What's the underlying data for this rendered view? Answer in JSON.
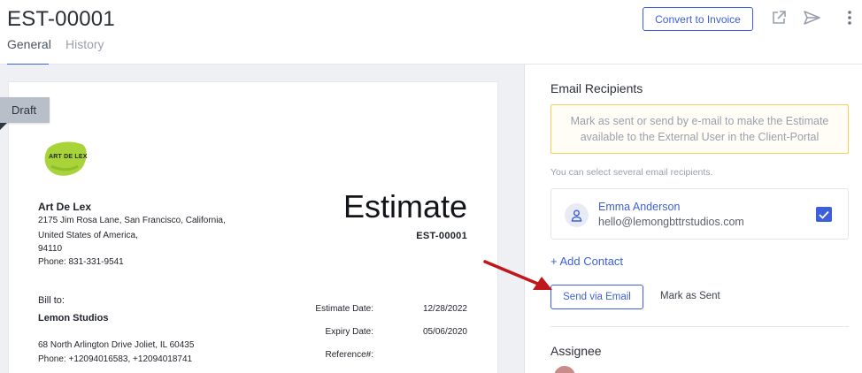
{
  "header": {
    "doc_id": "EST-00001",
    "tabs": [
      {
        "label": "General",
        "active": true
      },
      {
        "label": "History",
        "active": false
      }
    ],
    "convert_button": "Convert to Invoice",
    "icons": [
      "external-link-icon",
      "send-icon",
      "more-vertical-icon"
    ]
  },
  "document": {
    "draft_tag": "Draft",
    "logo_text": "ART DE LEX",
    "company": {
      "name": "Art De Lex",
      "address_line1": "2175 Jim Rosa Lane, San Francisco, California,",
      "address_line2": "United States of America,",
      "address_line3": "94110",
      "phone": "Phone: 831-331-9541"
    },
    "title": "Estimate",
    "number": "EST-00001",
    "bill_to": {
      "label": "Bill to:",
      "name": "Lemon Studios",
      "address": "68 North Arlington Drive Joliet, IL 60435",
      "phone": "Phone: +12094016583, +12094018741"
    },
    "meta": [
      {
        "label": "Estimate Date:",
        "value": "12/28/2022"
      },
      {
        "label": "Expiry Date:",
        "value": "05/06/2020"
      },
      {
        "label": "Reference#:",
        "value": ""
      }
    ]
  },
  "email_panel": {
    "title": "Email Recipients",
    "notice": "Mark as sent or send by e-mail to make the Estimate available to the External User in the Client-Portal",
    "hint": "You can select several email recipients.",
    "contact": {
      "name": "Emma Anderson",
      "email": "hello@lemongbttrstudios.com",
      "checked": true
    },
    "add_contact": "+ Add Contact",
    "send_button": "Send via Email",
    "mark_sent": "Mark as Sent"
  },
  "assignee": {
    "title": "Assignee"
  },
  "colors": {
    "accent": "#3d5fd9",
    "notice_border": "#f0cf5b",
    "annotation_arrow": "#c0171c",
    "logo_green": "#a8d43a"
  }
}
